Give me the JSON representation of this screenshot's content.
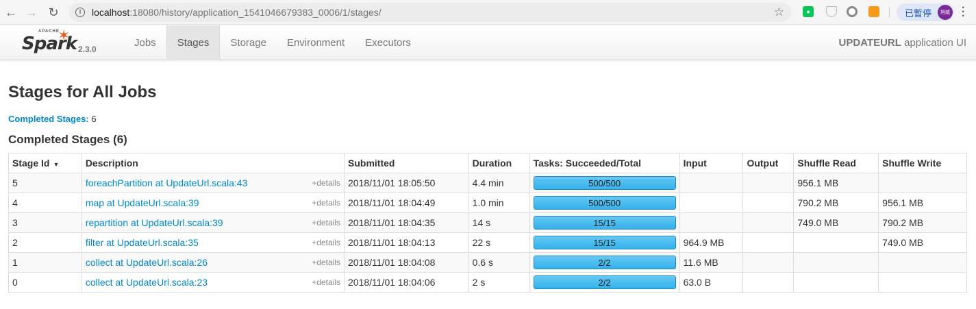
{
  "browser": {
    "url_host": "localhost",
    "url_rest": ":18080/history/application_1541046679383_0006/1/stages/",
    "profile_label": "已暫停",
    "avatar_text": "旭威"
  },
  "navbar": {
    "brand_apache": "APACHE",
    "brand_name": "Spark",
    "version": "2.3.0",
    "tabs": [
      {
        "label": "Jobs",
        "active": false
      },
      {
        "label": "Stages",
        "active": true
      },
      {
        "label": "Storage",
        "active": false
      },
      {
        "label": "Environment",
        "active": false
      },
      {
        "label": "Executors",
        "active": false
      }
    ],
    "app_name": "UPDATEURL",
    "app_suffix": " application UI"
  },
  "page": {
    "title": "Stages for All Jobs",
    "summary_label": "Completed Stages:",
    "summary_count": "6",
    "section_title": "Completed Stages (6)"
  },
  "table": {
    "headers": [
      "Stage Id",
      "Description",
      "Submitted",
      "Duration",
      "Tasks: Succeeded/Total",
      "Input",
      "Output",
      "Shuffle Read",
      "Shuffle Write"
    ],
    "details_label": "+details",
    "rows": [
      {
        "id": "5",
        "desc": "foreachPartition at UpdateUrl.scala:43",
        "submitted": "2018/11/01 18:05:50",
        "duration": "4.4 min",
        "tasks": "500/500",
        "progress": 1.0,
        "input": "",
        "output": "",
        "shuffle_read": "956.1 MB",
        "shuffle_write": ""
      },
      {
        "id": "4",
        "desc": "map at UpdateUrl.scala:39",
        "submitted": "2018/11/01 18:04:49",
        "duration": "1.0 min",
        "tasks": "500/500",
        "progress": 1.0,
        "input": "",
        "output": "",
        "shuffle_read": "790.2 MB",
        "shuffle_write": "956.1 MB"
      },
      {
        "id": "3",
        "desc": "repartition at UpdateUrl.scala:39",
        "submitted": "2018/11/01 18:04:35",
        "duration": "14 s",
        "tasks": "15/15",
        "progress": 1.0,
        "input": "",
        "output": "",
        "shuffle_read": "749.0 MB",
        "shuffle_write": "790.2 MB"
      },
      {
        "id": "2",
        "desc": "filter at UpdateUrl.scala:35",
        "submitted": "2018/11/01 18:04:13",
        "duration": "22 s",
        "tasks": "15/15",
        "progress": 1.0,
        "input": "964.9 MB",
        "output": "",
        "shuffle_read": "",
        "shuffle_write": "749.0 MB"
      },
      {
        "id": "1",
        "desc": "collect at UpdateUrl.scala:26",
        "submitted": "2018/11/01 18:04:08",
        "duration": "0.6 s",
        "tasks": "2/2",
        "progress": 1.0,
        "input": "11.6 MB",
        "output": "",
        "shuffle_read": "",
        "shuffle_write": ""
      },
      {
        "id": "0",
        "desc": "collect at UpdateUrl.scala:23",
        "submitted": "2018/11/01 18:04:06",
        "duration": "2 s",
        "tasks": "2/2",
        "progress": 1.0,
        "input": "63.0 B",
        "output": "",
        "shuffle_read": "",
        "shuffle_write": ""
      }
    ]
  },
  "colors": {
    "link": "#0088cc",
    "progress": "#34b1ea",
    "spark_orange": "#e25a1c"
  }
}
